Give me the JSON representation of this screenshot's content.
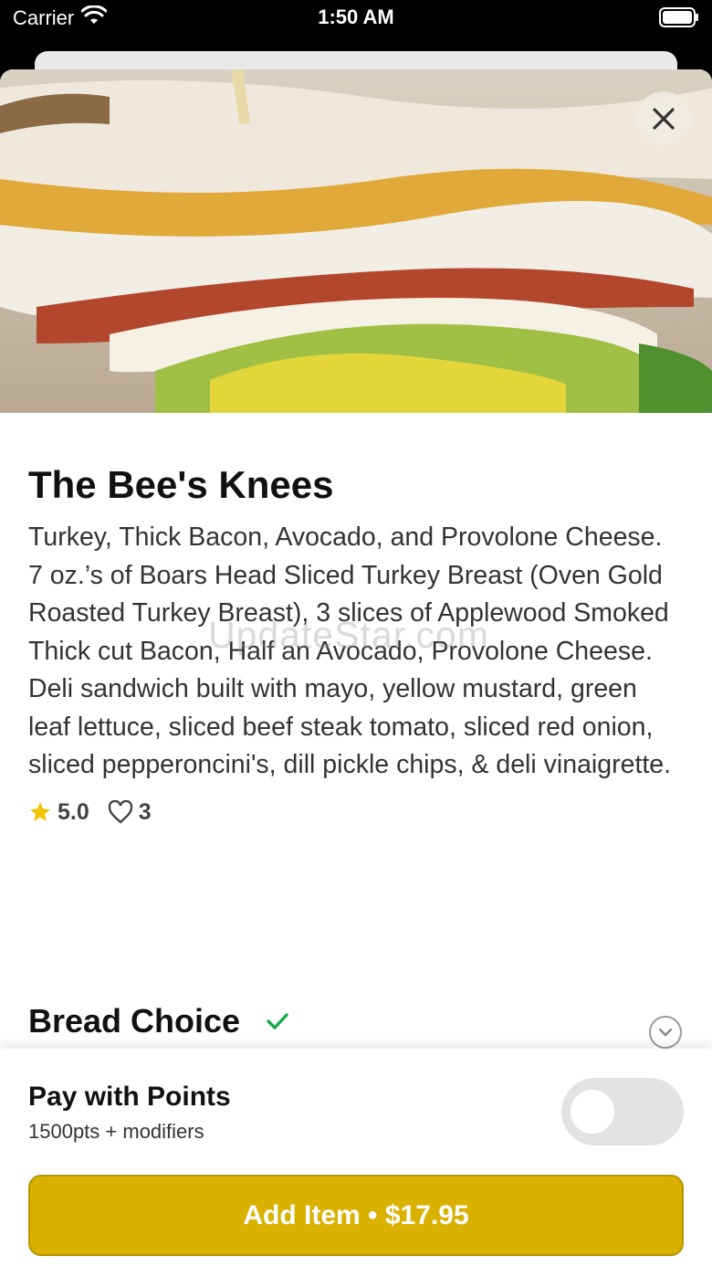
{
  "status_bar": {
    "carrier": "Carrier",
    "time": "1:50 AM",
    "wifi_icon": "wifi-icon",
    "battery_icon": "battery-icon"
  },
  "item": {
    "title": "The Bee's Knees",
    "description": "Turkey, Thick Bacon, Avocado, and Provolone Cheese. 7 oz.’s of Boars Head Sliced Turkey Breast (Oven Gold Roasted Turkey Breast), 3 slices of Applewood Smoked Thick cut Bacon, Half an Avocado, Provolone Cheese. Deli sandwich built with mayo, yellow mustard, green leaf lettuce, sliced beef steak tomato, sliced red onion, sliced pepperoncini's, dill pickle chips, & deli vinaigrette.",
    "rating": "5.0",
    "likes": "3",
    "star_icon": "star-icon",
    "heart_icon": "heart-icon"
  },
  "watermark": "UpdateStar.com",
  "section": {
    "title": "Bread Choice",
    "check_icon": "checkmark-icon",
    "chevron_icon": "chevron-down-icon"
  },
  "points": {
    "title": "Pay with Points",
    "subtitle": "1500pts + modifiers",
    "toggle_state": "off"
  },
  "add_button": {
    "label": "Add Item • $17.95"
  },
  "colors": {
    "accent": "#d9b100",
    "check": "#1aa84a",
    "star": "#f2c400"
  }
}
